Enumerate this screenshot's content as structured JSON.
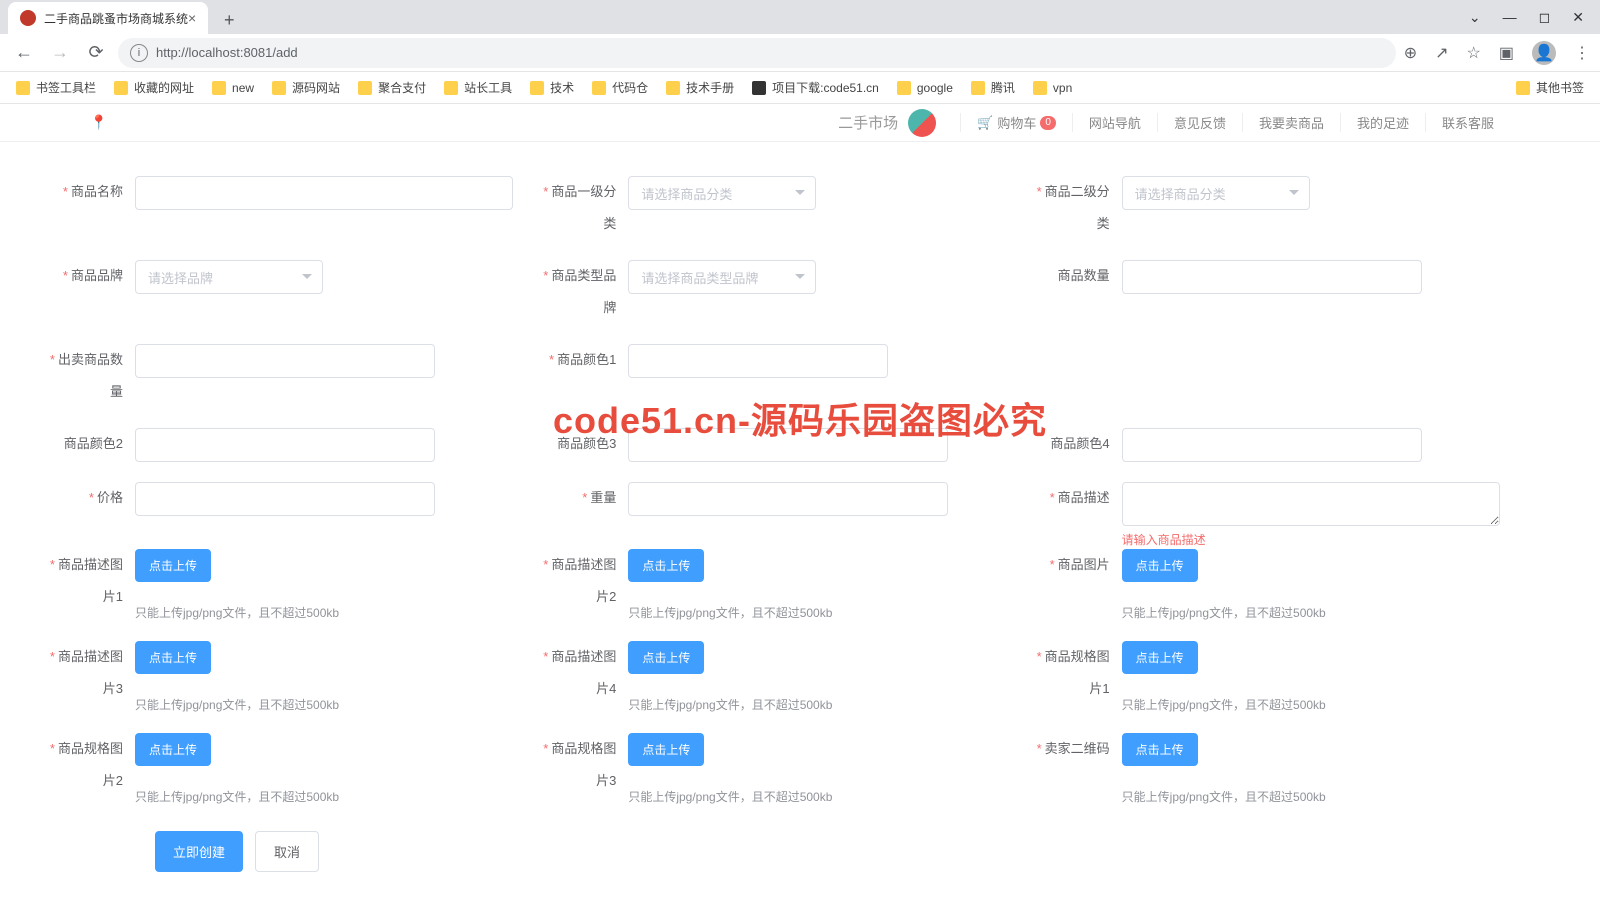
{
  "browser": {
    "tab_title": "二手商品跳蚤市场商城系统",
    "url": "http://localhost:8081/add",
    "new_tab": "+",
    "bookmarks": [
      "书签工具栏",
      "收藏的网址",
      "new",
      "源码网站",
      "聚合支付",
      "站长工具",
      "技术",
      "代码仓",
      "技术手册",
      "项目下载:code51.cn",
      "google",
      "腾讯",
      "vpn"
    ],
    "bookmark_overflow": "其他书签"
  },
  "header": {
    "logo_text": "二手市场",
    "cart_label": "购物车",
    "cart_badge": "0",
    "nav": [
      "网站导航",
      "意见反馈",
      "我要卖商品",
      "我的足迹",
      "联系客服"
    ]
  },
  "form": {
    "row1": {
      "name": {
        "label": "商品名称",
        "required": true
      },
      "cat1": {
        "label": "商品一级分类",
        "required": true,
        "placeholder": "请选择商品分类"
      },
      "cat2": {
        "label": "商品二级分类",
        "required": true,
        "placeholder": "请选择商品分类"
      }
    },
    "row2": {
      "brand": {
        "label": "商品品牌",
        "required": true,
        "placeholder": "请选择品牌"
      },
      "type_brand": {
        "label": "商品类型品牌",
        "required": true,
        "placeholder": "请选择商品类型品牌"
      },
      "qty": {
        "label": "商品数量",
        "required": false
      }
    },
    "row3": {
      "sell_qty": {
        "label": "出卖商品数量",
        "required": true
      },
      "color1": {
        "label": "商品颜色1",
        "required": true
      }
    },
    "row4": {
      "color2": {
        "label": "商品颜色2",
        "required": false
      },
      "color3": {
        "label": "商品颜色3",
        "required": false
      },
      "color4": {
        "label": "商品颜色4",
        "required": false
      }
    },
    "row5": {
      "price": {
        "label": "价格",
        "required": true
      },
      "weight": {
        "label": "重量",
        "required": true
      },
      "desc": {
        "label": "商品描述",
        "required": true,
        "error": "请输入商品描述"
      }
    },
    "uploads": {
      "items": [
        {
          "label": "商品描述图片1",
          "required": true
        },
        {
          "label": "商品描述图片2",
          "required": true
        },
        {
          "label": "商品图片",
          "required": true
        },
        {
          "label": "商品描述图片3",
          "required": true
        },
        {
          "label": "商品描述图片4",
          "required": true
        },
        {
          "label": "商品规格图片1",
          "required": true
        },
        {
          "label": "商品规格图片2",
          "required": true
        },
        {
          "label": "商品规格图片3",
          "required": true
        },
        {
          "label": "卖家二维码",
          "required": true
        }
      ],
      "btn_text": "点击上传",
      "hint": "只能上传jpg/png文件，且不超过500kb"
    },
    "actions": {
      "submit": "立即创建",
      "cancel": "取消"
    }
  },
  "watermark": "code51.cn-源码乐园盗图必究"
}
